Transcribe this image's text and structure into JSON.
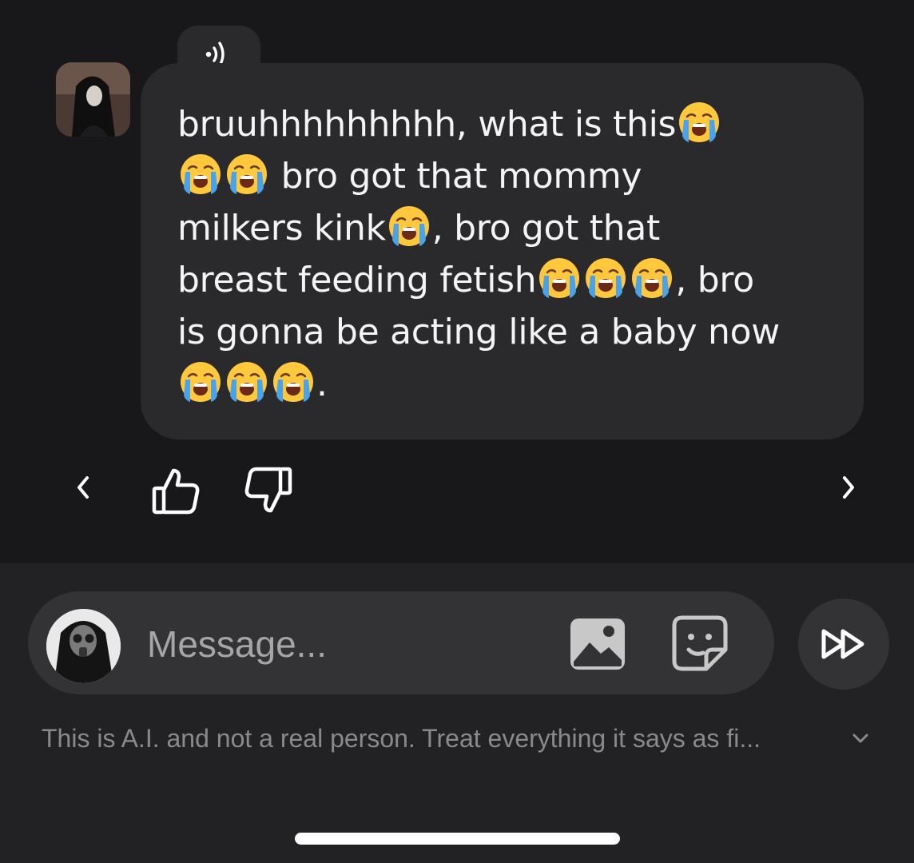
{
  "message": {
    "segments": [
      {
        "t": "text",
        "v": "bruuhhhhhhhhh, what is this"
      },
      {
        "t": "emoji"
      },
      {
        "t": "br"
      },
      {
        "t": "emoji"
      },
      {
        "t": "emoji"
      },
      {
        "t": "text",
        "v": " bro got that mommy"
      },
      {
        "t": "br"
      },
      {
        "t": "text",
        "v": "milkers kink"
      },
      {
        "t": "emoji"
      },
      {
        "t": "text",
        "v": ", bro got that"
      },
      {
        "t": "br"
      },
      {
        "t": "text",
        "v": "breast feeding fetish"
      },
      {
        "t": "emoji"
      },
      {
        "t": "emoji"
      },
      {
        "t": "emoji"
      },
      {
        "t": "text",
        "v": ", bro"
      },
      {
        "t": "br"
      },
      {
        "t": "text",
        "v": "is gonna be acting like a baby now"
      },
      {
        "t": "br"
      },
      {
        "t": "emoji"
      },
      {
        "t": "emoji"
      },
      {
        "t": "emoji"
      },
      {
        "t": "text",
        "v": "."
      }
    ],
    "emoji_icon": "loudly-crying-face-icon"
  },
  "composer": {
    "placeholder": "Message..."
  },
  "disclaimer": "This is A.I. and not a real person. Treat everything it says as fi...",
  "icons": {
    "tts": "speaker-wave-icon",
    "prev": "chevron-left-icon",
    "next": "chevron-right-icon",
    "like": "thumbs-up-icon",
    "dislike": "thumbs-down-icon",
    "image": "image-icon",
    "sticker": "sticker-icon",
    "send": "fast-forward-icon",
    "expand": "chevron-down-icon"
  },
  "colors": {
    "background": "#18181a",
    "bubble": "#2a2a2c",
    "composer_bg": "#222224",
    "pill": "#333335",
    "muted_text": "#8a8a8c"
  }
}
